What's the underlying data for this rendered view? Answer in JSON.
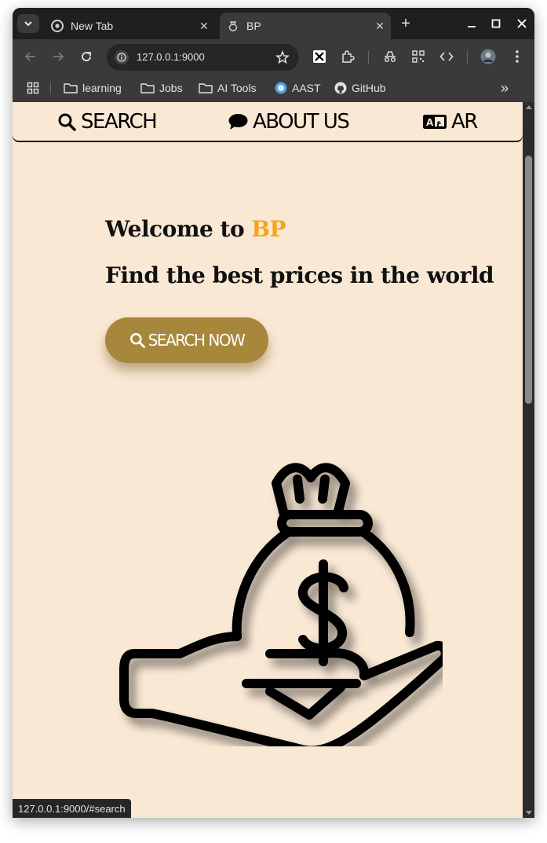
{
  "browser": {
    "tabs": [
      {
        "title": "New Tab",
        "icon": "chrome-icon",
        "active": false
      },
      {
        "title": "BP",
        "icon": "bp-favicon-icon",
        "active": true
      }
    ],
    "new_tab_label": "+",
    "address": "127.0.0.1:9000",
    "bookmarks": [
      {
        "label": "learning",
        "icon": "folder-icon"
      },
      {
        "label": "Jobs",
        "icon": "folder-icon"
      },
      {
        "label": "AI Tools",
        "icon": "folder-icon"
      },
      {
        "label": "AAST",
        "icon": "aast-icon"
      },
      {
        "label": "GitHub",
        "icon": "github-icon"
      }
    ],
    "bookmarks_overflow": "»",
    "status_url": "127.0.0.1:9000/#search"
  },
  "site": {
    "nav": [
      {
        "label": "SEARCH",
        "icon": "search-icon"
      },
      {
        "label": "ABOUT US",
        "icon": "speech-bubble-icon"
      },
      {
        "label": "AR",
        "icon": "language-icon"
      }
    ],
    "hero": {
      "welcome": "Welcome to ",
      "brand": "BP",
      "subtitle": "Find the best prices in the world",
      "cta_label": "SEARCH NOW"
    }
  },
  "colors": {
    "page_bg": "#f9e8d4",
    "brand_accent": "#f4a51c",
    "cta_bg": "#a6873b",
    "browser_chrome": "#3a3a3a",
    "tabstrip": "#1f1f1f"
  }
}
